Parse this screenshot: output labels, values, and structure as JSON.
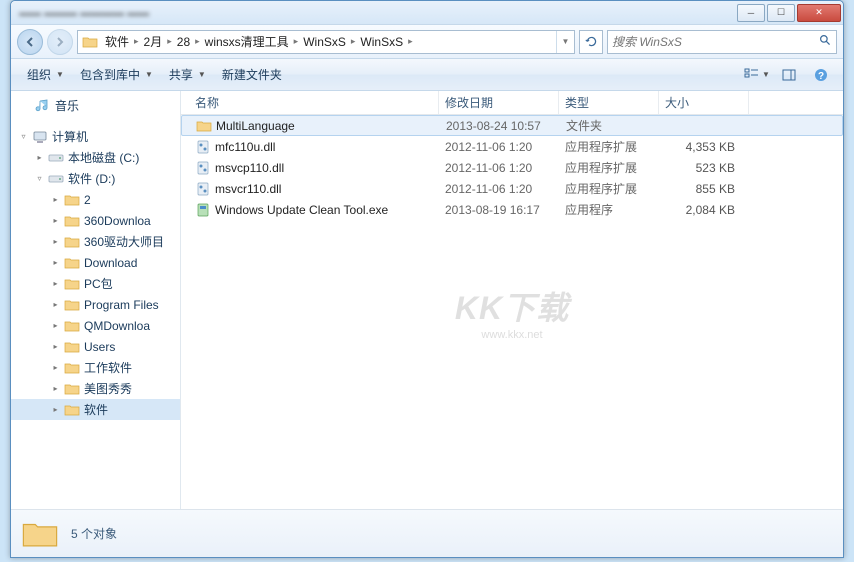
{
  "window_controls": {
    "min": "─",
    "max": "☐",
    "close": "✕"
  },
  "breadcrumb": [
    "软件",
    "2月",
    "28",
    "winsxs清理工具",
    "WinSxS",
    "WinSxS"
  ],
  "search": {
    "placeholder": "搜索 WinSxS"
  },
  "toolbar": {
    "organize": "组织",
    "include_in_library": "包含到库中",
    "share": "共享",
    "new_folder": "新建文件夹"
  },
  "sidebar": {
    "music": "音乐",
    "computer": "计算机",
    "drive_c": "本地磁盘 (C:)",
    "drive_d": "软件 (D:)",
    "folders": [
      "2",
      "360Downloa",
      "360驱动大师目",
      "Download",
      "PC包",
      "Program Files",
      "QMDownloa",
      "Users",
      "工作软件",
      "美图秀秀",
      "软件"
    ]
  },
  "columns": {
    "name": "名称",
    "date": "修改日期",
    "type": "类型",
    "size": "大小"
  },
  "column_widths": {
    "name": 250,
    "date": 120,
    "type": 100,
    "size": 90
  },
  "files": [
    {
      "icon": "folder",
      "name": "MultiLanguage",
      "date": "2013-08-24 10:57",
      "type": "文件夹",
      "size": "",
      "selected": true
    },
    {
      "icon": "dll",
      "name": "mfc110u.dll",
      "date": "2012-11-06 1:20",
      "type": "应用程序扩展",
      "size": "4,353 KB"
    },
    {
      "icon": "dll",
      "name": "msvcp110.dll",
      "date": "2012-11-06 1:20",
      "type": "应用程序扩展",
      "size": "523 KB"
    },
    {
      "icon": "dll",
      "name": "msvcr110.dll",
      "date": "2012-11-06 1:20",
      "type": "应用程序扩展",
      "size": "855 KB"
    },
    {
      "icon": "exe",
      "name": "Windows Update Clean Tool.exe",
      "date": "2013-08-19 16:17",
      "type": "应用程序",
      "size": "2,084 KB"
    }
  ],
  "watermark": {
    "main": "KK下载",
    "sub": "www.kkx.net"
  },
  "status": {
    "text": "5 个对象"
  }
}
